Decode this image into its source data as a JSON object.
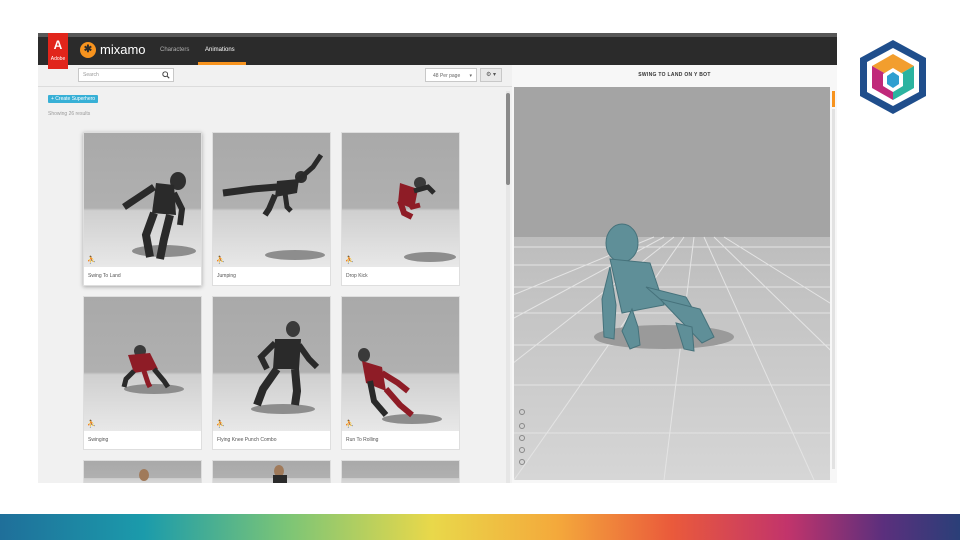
{
  "app": {
    "adobe_logo_text": "Adobe",
    "brand": "mixamo",
    "tabs": [
      "Characters",
      "Animations"
    ],
    "active_tab": "Animations",
    "accent_color": "#f7931e"
  },
  "toolbar": {
    "search_placeholder": "Search",
    "per_page": "48 Per page",
    "settings_label": "⚙ ▾"
  },
  "left": {
    "create_button": "+ Create Superhero",
    "results_text": "Showing 26 results"
  },
  "cards": [
    {
      "label": "Swing To Land",
      "selected": true
    },
    {
      "label": "Jumping"
    },
    {
      "label": "Drop Kick"
    },
    {
      "label": "Swinging"
    },
    {
      "label": "Flying Knee Punch Combo"
    },
    {
      "label": "Run To Rolling"
    }
  ],
  "viewer": {
    "title": "SWING TO LAND ON Y BOT"
  },
  "icons": [
    "search-icon",
    "gear-icon",
    "running-figure-icon",
    "help-icon",
    "hexagon-logo"
  ]
}
